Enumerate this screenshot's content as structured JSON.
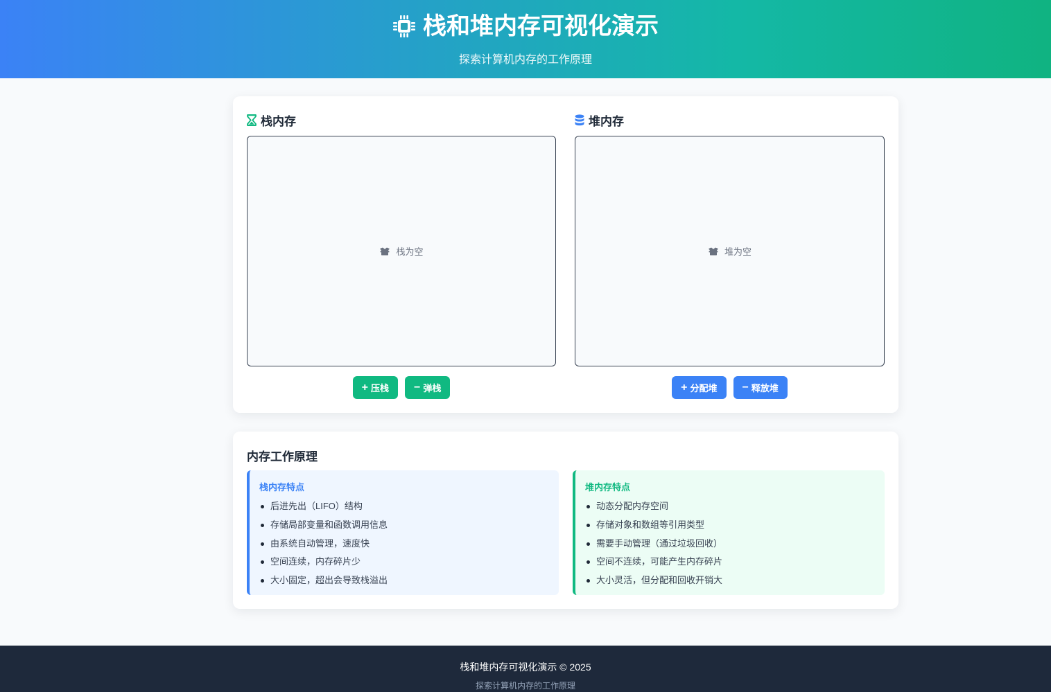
{
  "header": {
    "title": "栈和堆内存可视化演示",
    "subtitle": "探索计算机内存的工作原理",
    "icon": "microchip-icon"
  },
  "stack": {
    "title": "栈内存",
    "icon": "hourglass-icon",
    "empty_text": "栈为空",
    "push_label": "压栈",
    "pop_label": "弹栈"
  },
  "heap": {
    "title": "堆内存",
    "icon": "database-icon",
    "empty_text": "堆为空",
    "alloc_label": "分配堆",
    "free_label": "释放堆"
  },
  "principles": {
    "title": "内存工作原理",
    "stack": {
      "heading": "栈内存特点",
      "items": [
        "后进先出（LIFO）结构",
        "存储局部变量和函数调用信息",
        "由系统自动管理，速度快",
        "空间连续，内存碎片少",
        "大小固定，超出会导致栈溢出"
      ]
    },
    "heap": {
      "heading": "堆内存特点",
      "items": [
        "动态分配内存空间",
        "存储对象和数组等引用类型",
        "需要手动管理（通过垃圾回收）",
        "空间不连续，可能产生内存碎片",
        "大小灵活，但分配和回收开销大"
      ]
    }
  },
  "footer": {
    "main": "栈和堆内存可视化演示 © 2025",
    "sub": "探索计算机内存的工作原理"
  },
  "colors": {
    "stack_accent": "#10b981",
    "heap_accent": "#3b82f6",
    "footer_bg": "#1e293b"
  }
}
